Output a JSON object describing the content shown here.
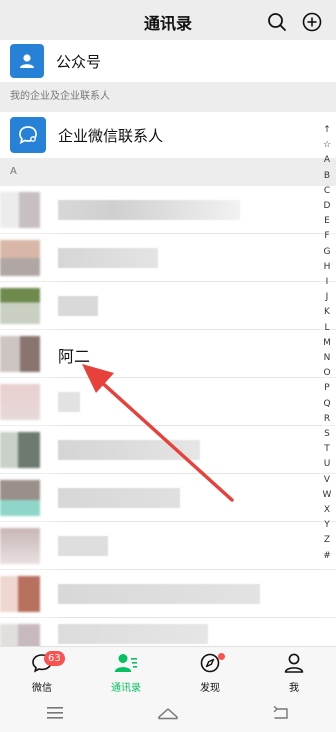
{
  "header": {
    "title": "通讯录"
  },
  "top_rows": {
    "official_accounts": "公众号"
  },
  "enterprise": {
    "section_title": "我的企业及企业联系人",
    "contacts_label": "企业微信联系人"
  },
  "section_a": {
    "letter": "A"
  },
  "contacts": {
    "highlighted_name": "阿二"
  },
  "alpha_index": [
    "↑",
    "☆",
    "A",
    "B",
    "C",
    "D",
    "E",
    "F",
    "G",
    "H",
    "I",
    "J",
    "K",
    "L",
    "M",
    "N",
    "O",
    "P",
    "Q",
    "R",
    "S",
    "T",
    "U",
    "V",
    "W",
    "X",
    "Y",
    "Z",
    "#"
  ],
  "tabbar": {
    "tabs": [
      {
        "label": "微信",
        "badge": "63"
      },
      {
        "label": "通讯录"
      },
      {
        "label": "发现"
      },
      {
        "label": "我"
      }
    ]
  },
  "colors": {
    "accent": "#07c160",
    "blue_tile": "#2782d7",
    "badge": "#fa5151",
    "arrow": "#e8403a"
  }
}
